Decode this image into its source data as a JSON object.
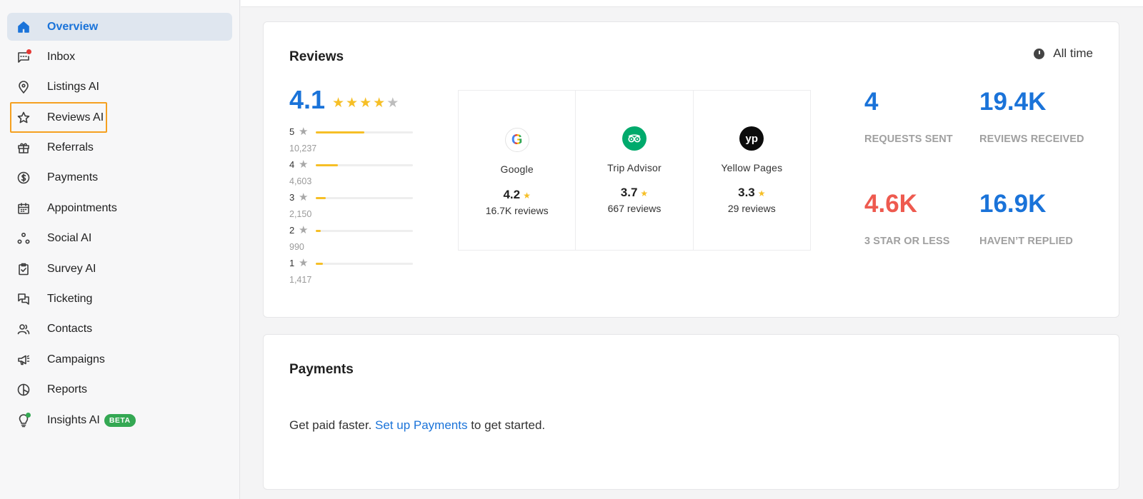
{
  "sidebar": {
    "items": [
      {
        "label": "Overview",
        "icon": "home-icon"
      },
      {
        "label": "Inbox",
        "icon": "inbox-icon"
      },
      {
        "label": "Listings AI",
        "icon": "location-pin-icon"
      },
      {
        "label": "Reviews AI",
        "icon": "star-icon"
      },
      {
        "label": "Referrals",
        "icon": "gift-icon"
      },
      {
        "label": "Payments",
        "icon": "dollar-circle-icon"
      },
      {
        "label": "Appointments",
        "icon": "calendar-icon"
      },
      {
        "label": "Social AI",
        "icon": "social-nodes-icon"
      },
      {
        "label": "Survey AI",
        "icon": "clipboard-check-icon"
      },
      {
        "label": "Ticketing",
        "icon": "chat-bubbles-icon"
      },
      {
        "label": "Contacts",
        "icon": "contacts-icon"
      },
      {
        "label": "Campaigns",
        "icon": "megaphone-icon"
      },
      {
        "label": "Reports",
        "icon": "pie-chart-icon"
      },
      {
        "label": "Insights AI",
        "icon": "lightbulb-icon",
        "badge": "BETA"
      }
    ]
  },
  "reviews": {
    "title": "Reviews",
    "time_filter": "All time",
    "overall_rating": "4.1",
    "star_fill": 4,
    "distribution": [
      {
        "stars": "5",
        "count": "10,237",
        "fraction": 0.5
      },
      {
        "stars": "4",
        "count": "4,603",
        "fraction": 0.23
      },
      {
        "stars": "3",
        "count": "2,150",
        "fraction": 0.1
      },
      {
        "stars": "2",
        "count": "990",
        "fraction": 0.05
      },
      {
        "stars": "1",
        "count": "1,417",
        "fraction": 0.07
      }
    ],
    "sources": [
      {
        "name": "Google",
        "rating": "4.2",
        "count": "16.7K reviews",
        "logo": "G"
      },
      {
        "name": "Trip Advisor",
        "rating": "3.7",
        "count": "667 reviews",
        "logo": ""
      },
      {
        "name": "Yellow Pages",
        "rating": "3.3",
        "count": "29 reviews",
        "logo": "yp"
      }
    ],
    "stats": [
      {
        "value": "4",
        "label": "REQUESTS SENT",
        "color": "#1a73d9"
      },
      {
        "value": "19.4K",
        "label": "REVIEWS RECEIVED",
        "color": "#1a73d9"
      },
      {
        "value": "4.6K",
        "label": "3 STAR OR LESS",
        "color": "#ee5a4f"
      },
      {
        "value": "16.9K",
        "label": "HAVEN’T REPLIED",
        "color": "#1a73d9"
      }
    ]
  },
  "payments": {
    "title": "Payments",
    "text_before": "Get paid faster. ",
    "link": "Set up Payments",
    "text_after": " to get started."
  },
  "colors": {
    "accent": "#1a73d9",
    "star": "#f6bf26",
    "highlight": "#f5a020",
    "beta": "#34a853",
    "negative": "#ee5a4f"
  }
}
